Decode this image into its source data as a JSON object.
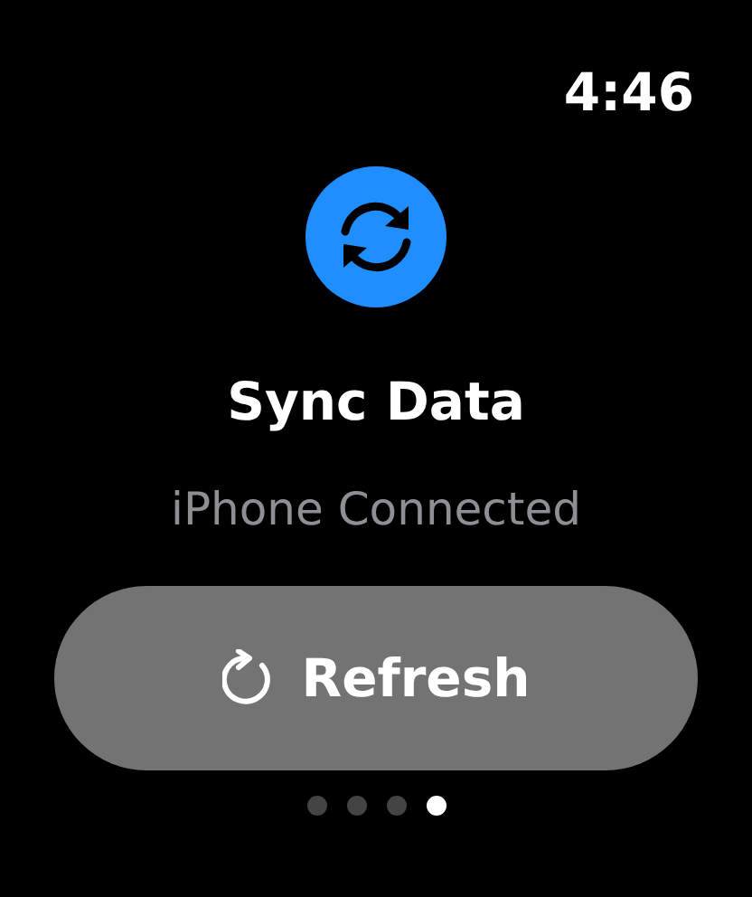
{
  "status_bar": {
    "time": "4:46"
  },
  "title": "Sync Data",
  "subtitle": "iPhone Connected",
  "button": {
    "label": "Refresh"
  },
  "page_dots": [
    {
      "selected": false
    },
    {
      "selected": false
    },
    {
      "selected": false
    },
    {
      "selected": true
    }
  ]
}
